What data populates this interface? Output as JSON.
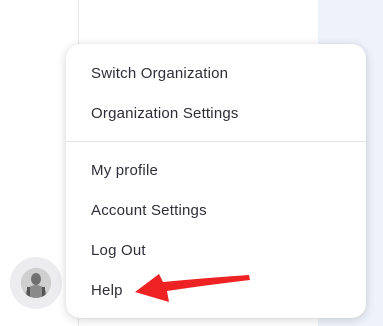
{
  "account_menu": {
    "items": [
      {
        "label": "Switch Organization"
      },
      {
        "label": "Organization Settings"
      },
      {
        "label": "My profile"
      },
      {
        "label": "Account Settings"
      },
      {
        "label": "Log Out"
      },
      {
        "label": "Help"
      }
    ]
  },
  "annotation": {
    "arrow_color": "#ee2222"
  },
  "icons": {
    "avatar": "user-avatar-icon"
  }
}
